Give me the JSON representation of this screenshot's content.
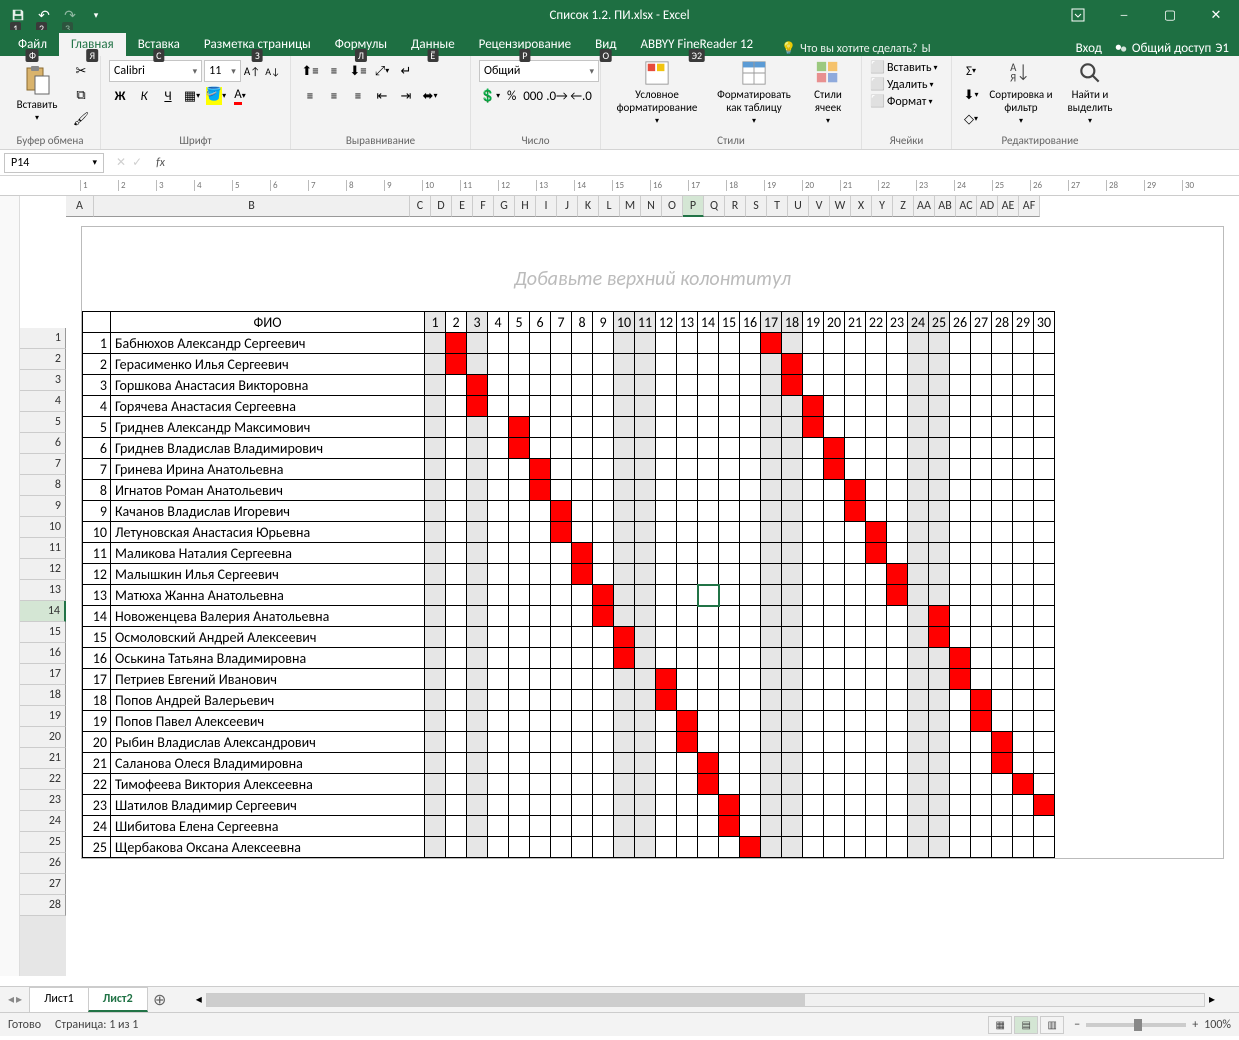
{
  "app": {
    "title": "Список 1.2. ПИ.xlsx - Excel",
    "suffix": "Excel"
  },
  "qat": {
    "save_tip": "1",
    "undo_tip": "2",
    "redo_tip": "3"
  },
  "tabs": {
    "file": "Файл",
    "home": "Главная",
    "insert": "Вставка",
    "page_layout": "Разметка страницы",
    "formulas": "Формулы",
    "data": "Данные",
    "review": "Рецензирование",
    "view": "Вид",
    "abbyy": "ABBYY FineReader 12",
    "keytips": {
      "file": "Ф",
      "home": "Я",
      "insert": "С",
      "page_layout": "З",
      "formulas": "Л",
      "data": "Ё",
      "review": "Р",
      "view": "О",
      "abbyy": "Э2",
      "tellme": "Ы",
      "share": "Э1"
    }
  },
  "tell_me": "Что вы хотите сделать?",
  "account": {
    "login": "Вход",
    "share": "Общий доступ"
  },
  "ribbon": {
    "clipboard": {
      "label": "Буфер обмена",
      "paste": "Вставить"
    },
    "font": {
      "label": "Шрифт",
      "name": "Calibri",
      "size": "11",
      "bold": "Ж",
      "italic": "К",
      "underline": "Ч"
    },
    "alignment": {
      "label": "Выравнивание"
    },
    "number": {
      "label": "Число",
      "format": "Общий"
    },
    "styles": {
      "label": "Стили",
      "cond": "Условное форматирование",
      "table": "Форматировать как таблицу",
      "cell": "Стили ячеек"
    },
    "cells": {
      "label": "Ячейки",
      "insert": "Вставить",
      "delete": "Удалить",
      "format": "Формат"
    },
    "editing": {
      "label": "Редактирование",
      "sort": "Сортировка и фильтр",
      "find": "Найти и выделить"
    }
  },
  "name_box": "P14",
  "header_placeholder": "Добавьте верхний колонтитул",
  "columns": [
    "A",
    "B",
    "C",
    "D",
    "E",
    "F",
    "G",
    "H",
    "I",
    "J",
    "K",
    "L",
    "M",
    "N",
    "O",
    "P",
    "Q",
    "R",
    "S",
    "T",
    "U",
    "V",
    "W",
    "X",
    "Y",
    "Z",
    "AA",
    "AB",
    "AC",
    "AD",
    "AE",
    "AF"
  ],
  "selected_col": "P",
  "selected_row": 14,
  "table": {
    "head_fio": "ФИО",
    "day_numbers": [
      1,
      2,
      3,
      4,
      5,
      6,
      7,
      8,
      9,
      10,
      11,
      12,
      13,
      14,
      15,
      16,
      17,
      18,
      19,
      20,
      21,
      22,
      23,
      24,
      25,
      26,
      27,
      28,
      29,
      30
    ],
    "gray_days": [
      1,
      3,
      10,
      11,
      17,
      18,
      24,
      25
    ],
    "rows": [
      {
        "n": 1,
        "name": "Бабнюхов Александр Сергеевич",
        "red": [
          2,
          17
        ]
      },
      {
        "n": 2,
        "name": "Герасименко Илья Сергеевич",
        "red": [
          2,
          18
        ]
      },
      {
        "n": 3,
        "name": "Горшкова Анастасия Викторовна",
        "red": [
          3,
          18
        ]
      },
      {
        "n": 4,
        "name": "Горячева Анастасия Сергеевна",
        "red": [
          3,
          19
        ]
      },
      {
        "n": 5,
        "name": "Гриднев Александр Максимович",
        "red": [
          5,
          19
        ]
      },
      {
        "n": 6,
        "name": "Гриднев Владислав Владимирович",
        "red": [
          5,
          20
        ]
      },
      {
        "n": 7,
        "name": "Гринева Ирина Анатольевна",
        "red": [
          6,
          20
        ]
      },
      {
        "n": 8,
        "name": "Игнатов Роман Анатольевич",
        "red": [
          6,
          21
        ]
      },
      {
        "n": 9,
        "name": "Качанов Владислав Игоревич",
        "red": [
          7,
          21
        ]
      },
      {
        "n": 10,
        "name": "Летуновская Анастасия Юрьевна",
        "red": [
          7,
          22
        ]
      },
      {
        "n": 11,
        "name": "Маликова Наталия Сергеевна",
        "red": [
          8,
          22
        ]
      },
      {
        "n": 12,
        "name": "Малышкин Илья Сергеевич",
        "red": [
          8,
          23
        ]
      },
      {
        "n": 13,
        "name": "Матюха Жанна Анатольевна",
        "red": [
          9,
          23
        ]
      },
      {
        "n": 14,
        "name": "Новоженцева Валерия Анатольевна",
        "red": [
          9,
          25
        ]
      },
      {
        "n": 15,
        "name": "Осмоловский Андрей Алексеевич",
        "red": [
          10,
          25
        ]
      },
      {
        "n": 16,
        "name": "Оськина Татьяна Владимировна",
        "red": [
          10,
          26
        ]
      },
      {
        "n": 17,
        "name": "Петриев Евгений Иванович",
        "red": [
          12,
          26
        ]
      },
      {
        "n": 18,
        "name": "Попов Андрей Валерьевич",
        "red": [
          12,
          27
        ]
      },
      {
        "n": 19,
        "name": "Попов Павел Алексеевич",
        "red": [
          13,
          27
        ]
      },
      {
        "n": 20,
        "name": "Рыбин Владислав Александрович",
        "red": [
          13,
          28
        ]
      },
      {
        "n": 21,
        "name": "Саланова Олеся Владимировна",
        "red": [
          14,
          28
        ]
      },
      {
        "n": 22,
        "name": "Тимофеева Виктория Алексеевна",
        "red": [
          14,
          29
        ]
      },
      {
        "n": 23,
        "name": "Шатилов Владимир Сергеевич",
        "red": [
          15,
          30
        ]
      },
      {
        "n": 24,
        "name": "Шибитова Елена Сергеевна",
        "red": [
          15
        ]
      },
      {
        "n": 25,
        "name": "Щербакова Оксана Алексеевна",
        "red": [
          16
        ]
      }
    ]
  },
  "sheets": {
    "tabs": [
      "Лист1",
      "Лист2"
    ],
    "active": "Лист2"
  },
  "status": {
    "ready": "Готово",
    "page": "Страница: 1 из 1",
    "zoom": "100%"
  }
}
